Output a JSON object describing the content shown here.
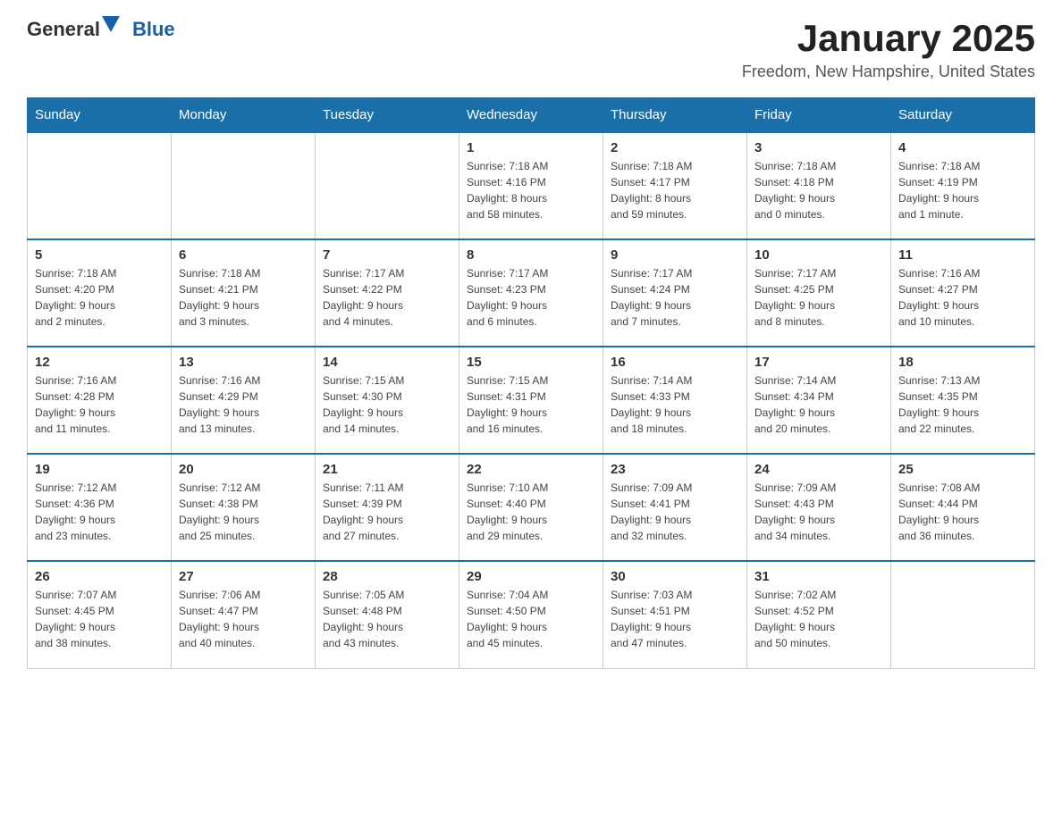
{
  "logo": {
    "general": "General",
    "blue": "Blue"
  },
  "header": {
    "title": "January 2025",
    "subtitle": "Freedom, New Hampshire, United States"
  },
  "days_of_week": [
    "Sunday",
    "Monday",
    "Tuesday",
    "Wednesday",
    "Thursday",
    "Friday",
    "Saturday"
  ],
  "weeks": [
    [
      {
        "day": "",
        "info": ""
      },
      {
        "day": "",
        "info": ""
      },
      {
        "day": "",
        "info": ""
      },
      {
        "day": "1",
        "info": "Sunrise: 7:18 AM\nSunset: 4:16 PM\nDaylight: 8 hours\nand 58 minutes."
      },
      {
        "day": "2",
        "info": "Sunrise: 7:18 AM\nSunset: 4:17 PM\nDaylight: 8 hours\nand 59 minutes."
      },
      {
        "day": "3",
        "info": "Sunrise: 7:18 AM\nSunset: 4:18 PM\nDaylight: 9 hours\nand 0 minutes."
      },
      {
        "day": "4",
        "info": "Sunrise: 7:18 AM\nSunset: 4:19 PM\nDaylight: 9 hours\nand 1 minute."
      }
    ],
    [
      {
        "day": "5",
        "info": "Sunrise: 7:18 AM\nSunset: 4:20 PM\nDaylight: 9 hours\nand 2 minutes."
      },
      {
        "day": "6",
        "info": "Sunrise: 7:18 AM\nSunset: 4:21 PM\nDaylight: 9 hours\nand 3 minutes."
      },
      {
        "day": "7",
        "info": "Sunrise: 7:17 AM\nSunset: 4:22 PM\nDaylight: 9 hours\nand 4 minutes."
      },
      {
        "day": "8",
        "info": "Sunrise: 7:17 AM\nSunset: 4:23 PM\nDaylight: 9 hours\nand 6 minutes."
      },
      {
        "day": "9",
        "info": "Sunrise: 7:17 AM\nSunset: 4:24 PM\nDaylight: 9 hours\nand 7 minutes."
      },
      {
        "day": "10",
        "info": "Sunrise: 7:17 AM\nSunset: 4:25 PM\nDaylight: 9 hours\nand 8 minutes."
      },
      {
        "day": "11",
        "info": "Sunrise: 7:16 AM\nSunset: 4:27 PM\nDaylight: 9 hours\nand 10 minutes."
      }
    ],
    [
      {
        "day": "12",
        "info": "Sunrise: 7:16 AM\nSunset: 4:28 PM\nDaylight: 9 hours\nand 11 minutes."
      },
      {
        "day": "13",
        "info": "Sunrise: 7:16 AM\nSunset: 4:29 PM\nDaylight: 9 hours\nand 13 minutes."
      },
      {
        "day": "14",
        "info": "Sunrise: 7:15 AM\nSunset: 4:30 PM\nDaylight: 9 hours\nand 14 minutes."
      },
      {
        "day": "15",
        "info": "Sunrise: 7:15 AM\nSunset: 4:31 PM\nDaylight: 9 hours\nand 16 minutes."
      },
      {
        "day": "16",
        "info": "Sunrise: 7:14 AM\nSunset: 4:33 PM\nDaylight: 9 hours\nand 18 minutes."
      },
      {
        "day": "17",
        "info": "Sunrise: 7:14 AM\nSunset: 4:34 PM\nDaylight: 9 hours\nand 20 minutes."
      },
      {
        "day": "18",
        "info": "Sunrise: 7:13 AM\nSunset: 4:35 PM\nDaylight: 9 hours\nand 22 minutes."
      }
    ],
    [
      {
        "day": "19",
        "info": "Sunrise: 7:12 AM\nSunset: 4:36 PM\nDaylight: 9 hours\nand 23 minutes."
      },
      {
        "day": "20",
        "info": "Sunrise: 7:12 AM\nSunset: 4:38 PM\nDaylight: 9 hours\nand 25 minutes."
      },
      {
        "day": "21",
        "info": "Sunrise: 7:11 AM\nSunset: 4:39 PM\nDaylight: 9 hours\nand 27 minutes."
      },
      {
        "day": "22",
        "info": "Sunrise: 7:10 AM\nSunset: 4:40 PM\nDaylight: 9 hours\nand 29 minutes."
      },
      {
        "day": "23",
        "info": "Sunrise: 7:09 AM\nSunset: 4:41 PM\nDaylight: 9 hours\nand 32 minutes."
      },
      {
        "day": "24",
        "info": "Sunrise: 7:09 AM\nSunset: 4:43 PM\nDaylight: 9 hours\nand 34 minutes."
      },
      {
        "day": "25",
        "info": "Sunrise: 7:08 AM\nSunset: 4:44 PM\nDaylight: 9 hours\nand 36 minutes."
      }
    ],
    [
      {
        "day": "26",
        "info": "Sunrise: 7:07 AM\nSunset: 4:45 PM\nDaylight: 9 hours\nand 38 minutes."
      },
      {
        "day": "27",
        "info": "Sunrise: 7:06 AM\nSunset: 4:47 PM\nDaylight: 9 hours\nand 40 minutes."
      },
      {
        "day": "28",
        "info": "Sunrise: 7:05 AM\nSunset: 4:48 PM\nDaylight: 9 hours\nand 43 minutes."
      },
      {
        "day": "29",
        "info": "Sunrise: 7:04 AM\nSunset: 4:50 PM\nDaylight: 9 hours\nand 45 minutes."
      },
      {
        "day": "30",
        "info": "Sunrise: 7:03 AM\nSunset: 4:51 PM\nDaylight: 9 hours\nand 47 minutes."
      },
      {
        "day": "31",
        "info": "Sunrise: 7:02 AM\nSunset: 4:52 PM\nDaylight: 9 hours\nand 50 minutes."
      },
      {
        "day": "",
        "info": ""
      }
    ]
  ]
}
